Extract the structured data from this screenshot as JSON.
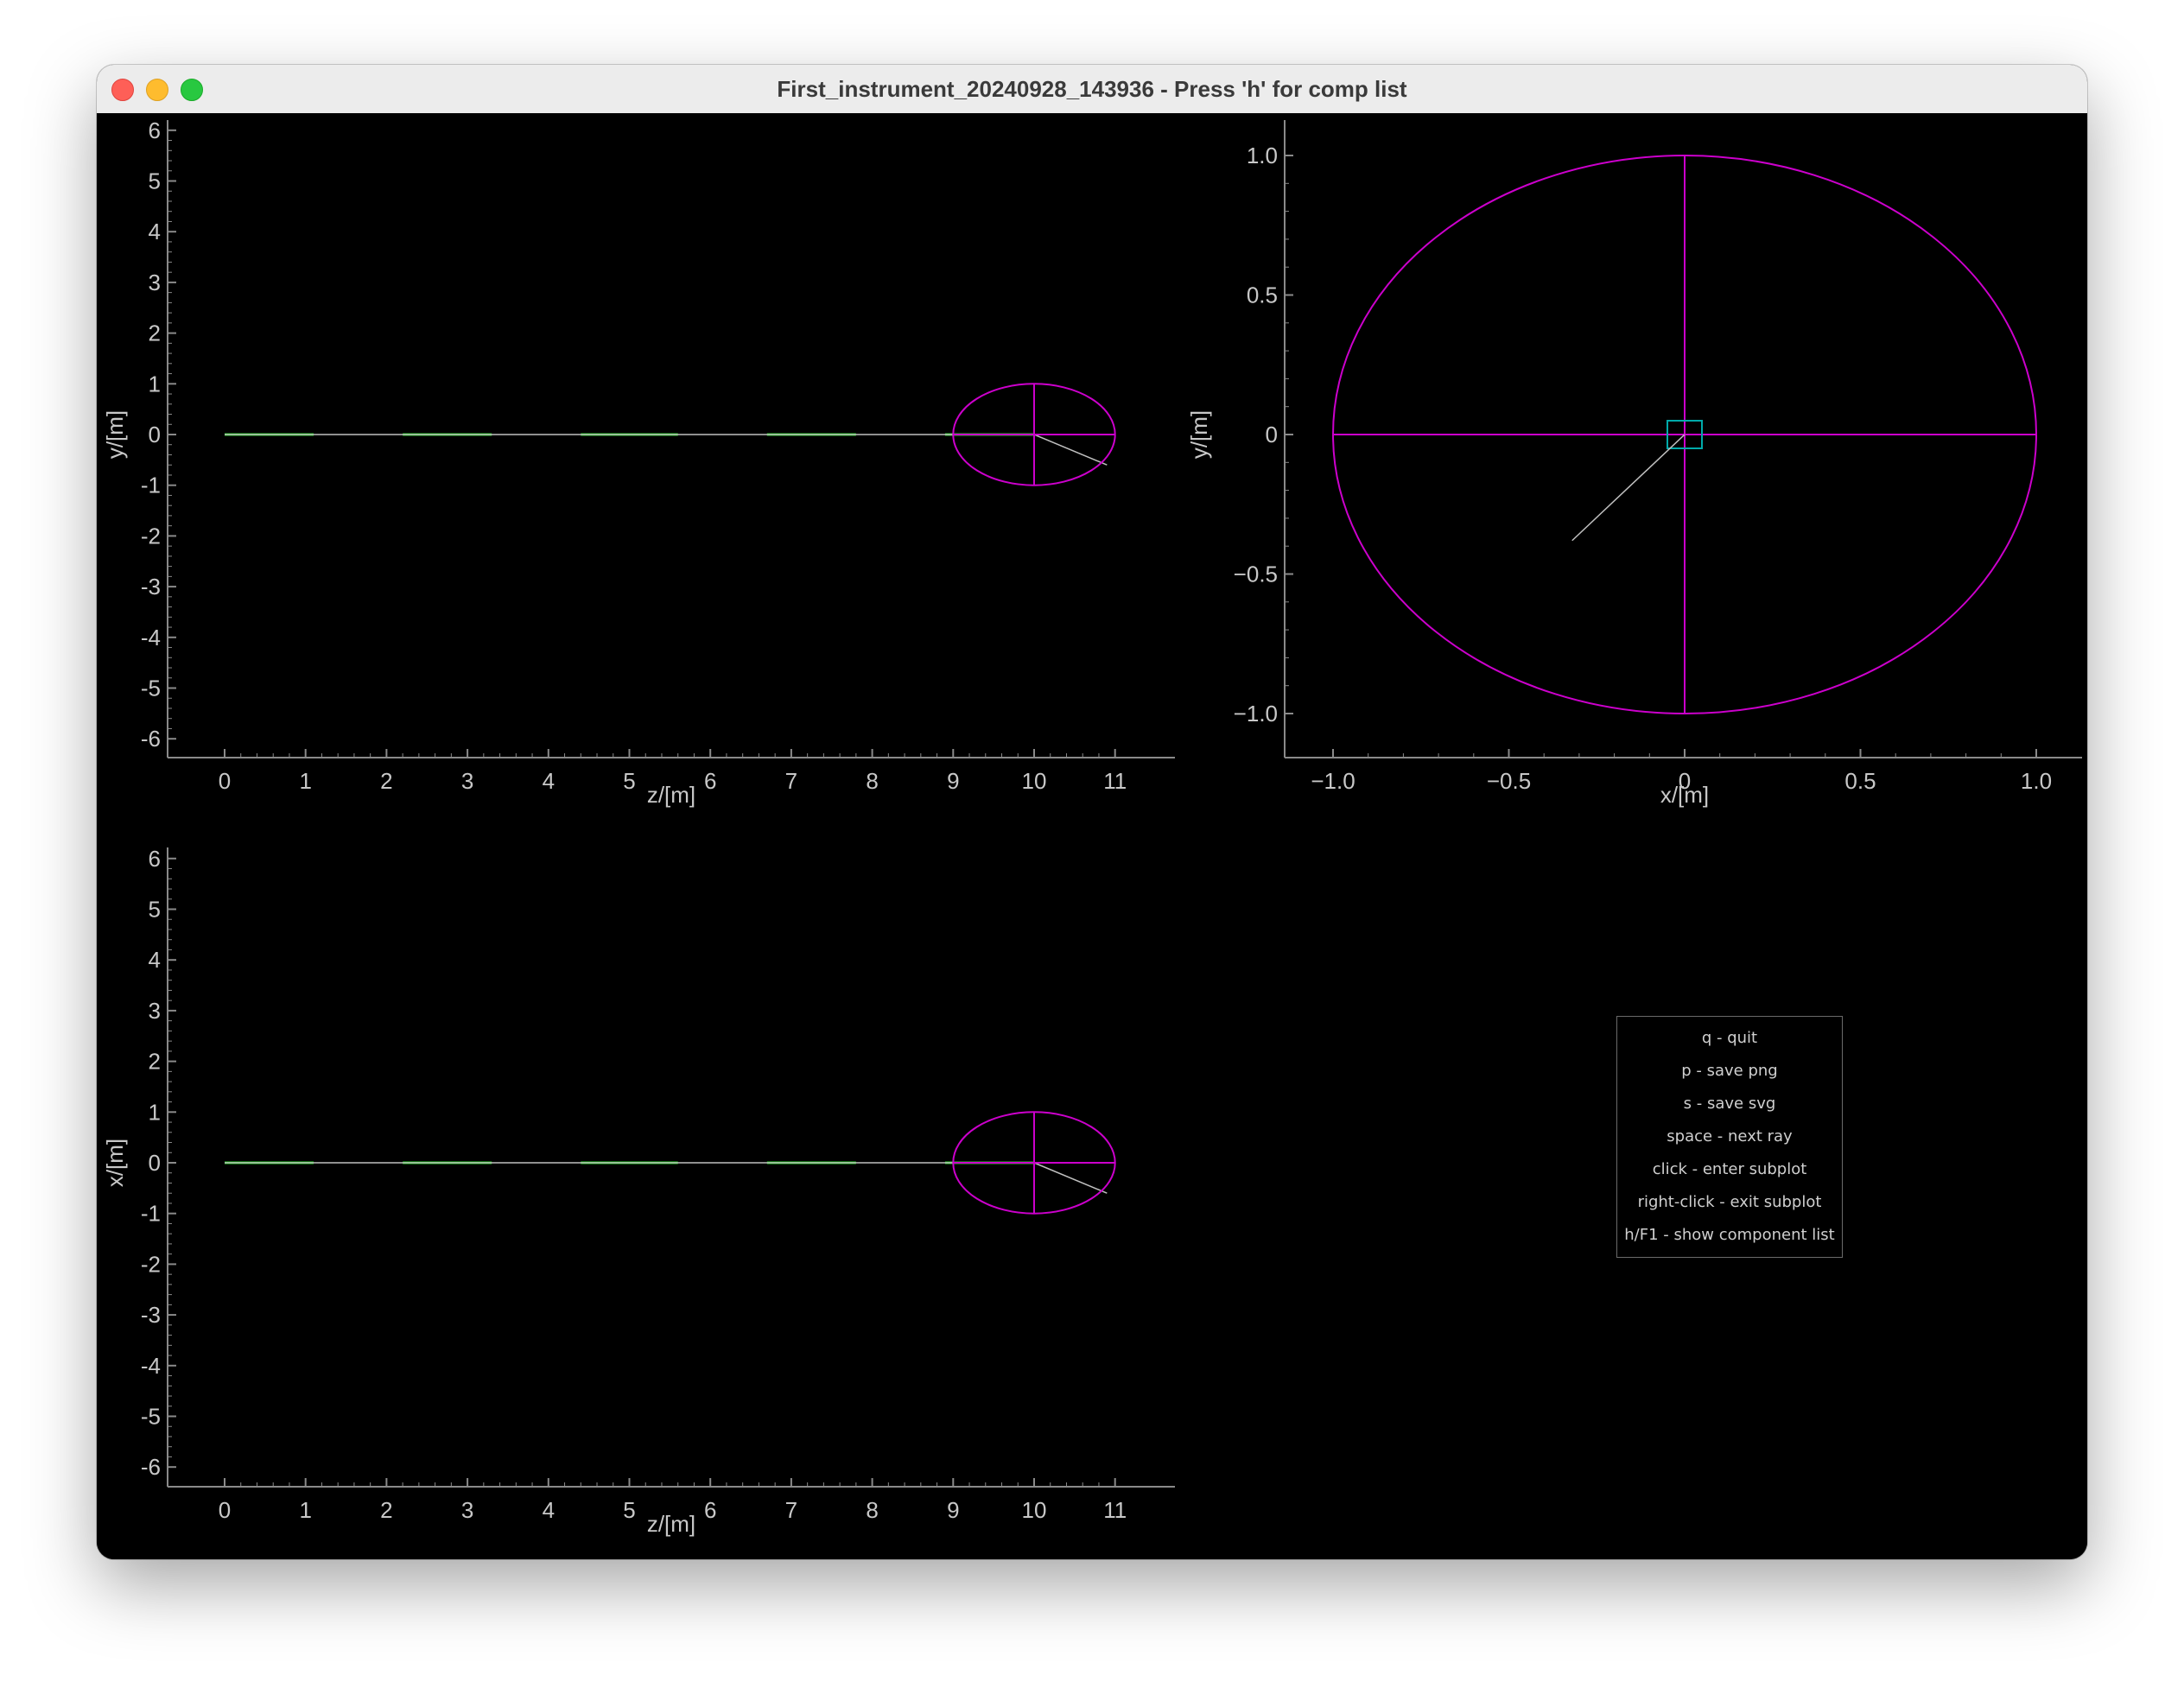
{
  "window": {
    "title": "First_instrument_20240928_143936 - Press 'h' for comp list"
  },
  "plots": [
    {
      "id": "yz",
      "xlabel": "z/[m]",
      "ylabel": "y/[m]",
      "xticks": [
        "0",
        "1",
        "2",
        "3",
        "4",
        "5",
        "6",
        "7",
        "8",
        "9",
        "10",
        "11"
      ],
      "yticks": [
        "6",
        "5",
        "4",
        "3",
        "2",
        "1",
        "0",
        "-1",
        "-2",
        "-3",
        "-4",
        "-5",
        "-6"
      ]
    },
    {
      "id": "xy",
      "xlabel": "x/[m]",
      "ylabel": "y/[m]",
      "xticks": [
        "−1.0",
        "−0.5",
        "0",
        "0.5",
        "1.0"
      ],
      "yticks": [
        "1.0",
        "0.5",
        "0",
        "−0.5",
        "−1.0"
      ]
    },
    {
      "id": "xz",
      "xlabel": "z/[m]",
      "ylabel": "x/[m]",
      "xticks": [
        "0",
        "1",
        "2",
        "3",
        "4",
        "5",
        "6",
        "7",
        "8",
        "9",
        "10",
        "11"
      ],
      "yticks": [
        "6",
        "5",
        "4",
        "3",
        "2",
        "1",
        "0",
        "-1",
        "-2",
        "-3",
        "-4",
        "-5",
        "-6"
      ]
    }
  ],
  "help": {
    "lines": [
      "q - quit",
      "p - save png",
      "s - save svg",
      "space - next ray",
      "click - enter subplot",
      "right-click - exit subplot",
      "h/F1 - show component list"
    ]
  },
  "colors": {
    "background": "#000000",
    "axis": "#8a8a8a",
    "component_ellipse": "#cc00cc",
    "component_segments": "#22cc22",
    "ray": "#c0c0c0",
    "monitor_box": "#00aaaa"
  }
}
